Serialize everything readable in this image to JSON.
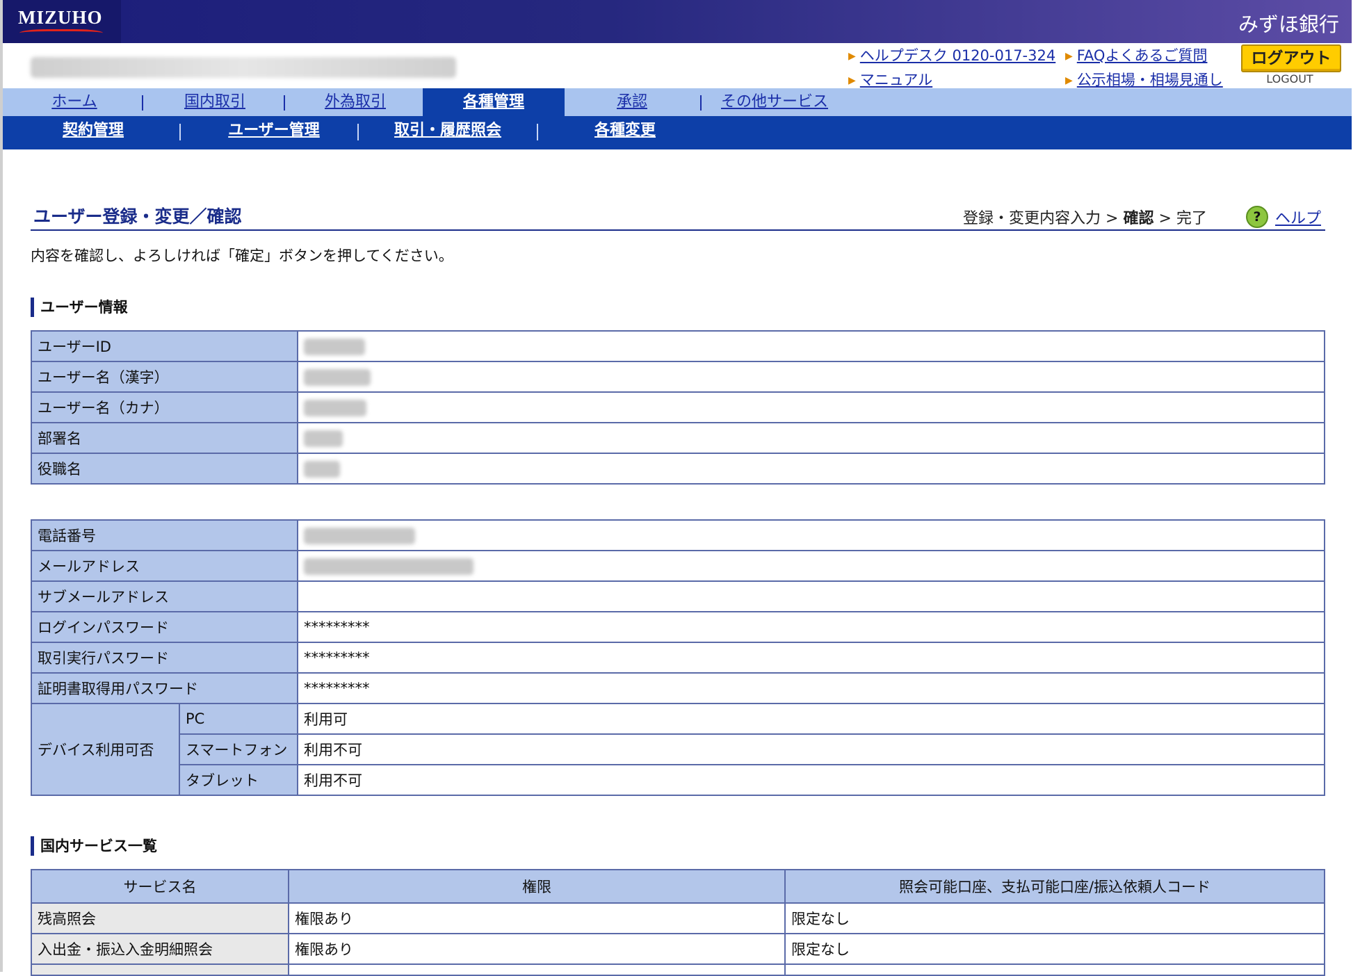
{
  "header": {
    "logo": "MIZUHO",
    "bank_name": "みずほ銀行",
    "links": {
      "helpdesk": "ヘルプデスク 0120-017-324",
      "faq": "FAQよくあるご質問",
      "manual": "マニュアル",
      "market": "公示相場・相場見通し"
    },
    "logout_label": "ログアウト",
    "logout_sub": "LOGOUT"
  },
  "nav": {
    "main": [
      "ホーム",
      "国内取引",
      "外為取引",
      "各種管理",
      "承認",
      "その他サービス"
    ],
    "active": "各種管理",
    "sub": [
      "契約管理",
      "ユーザー管理",
      "取引・履歴照会",
      "各種変更"
    ]
  },
  "page": {
    "title": "ユーザー登録・変更／確認",
    "steps": {
      "step1": "登録・変更内容入力",
      "sep": ">",
      "step2": "確認",
      "step3": "完了"
    },
    "help_icon": "?",
    "help": "ヘルプ",
    "instruction": "内容を確認し、よろしければ「確定」ボタンを押してください。"
  },
  "user_info": {
    "heading": "ユーザー情報",
    "rows": [
      {
        "label": "ユーザーID"
      },
      {
        "label": "ユーザー名（漢字）"
      },
      {
        "label": "ユーザー名（カナ）"
      },
      {
        "label": "部署名"
      },
      {
        "label": "役職名"
      }
    ]
  },
  "contact": {
    "phone": "電話番号",
    "email": "メールアドレス",
    "sub_email": "サブメールアドレス",
    "login_pw": {
      "label": "ログインパスワード",
      "value": "*********"
    },
    "tx_pw": {
      "label": "取引実行パスワード",
      "value": "*********"
    },
    "cert_pw": {
      "label": "証明書取得用パスワード",
      "value": "*********"
    },
    "device": {
      "label": "デバイス利用可否",
      "items": [
        {
          "name": "PC",
          "value": "利用可"
        },
        {
          "name": "スマートフォン",
          "value": "利用不可"
        },
        {
          "name": "タブレット",
          "value": "利用不可"
        }
      ]
    }
  },
  "services": {
    "heading": "国内サービス一覧",
    "columns": [
      "サービス名",
      "権限",
      "照会可能口座、支払可能口座/振込依頼人コード"
    ],
    "rows": [
      [
        "残高照会",
        "権限あり",
        "限定なし"
      ],
      [
        "入出金・振込入金明細照会",
        "権限あり",
        "限定なし"
      ]
    ]
  }
}
